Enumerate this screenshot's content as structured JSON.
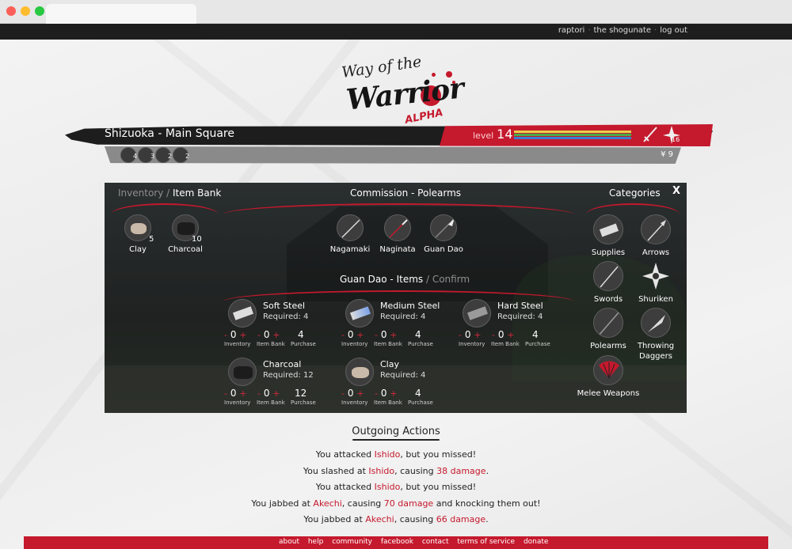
{
  "header": {
    "links": [
      "raptori",
      "the shogunate",
      "log out"
    ]
  },
  "logo": {
    "line1": "Way of the",
    "line2": "Warrior",
    "tag": "ALPHA"
  },
  "location": {
    "title": "Shizuoka - Main Square",
    "level_label": "level",
    "level": "14",
    "weapon_count": "16",
    "money": "¥ 9",
    "quick_items": [
      "4",
      "3",
      "2",
      "2"
    ]
  },
  "inventory": {
    "tab_inventory": "Inventory /",
    "tab_itembank": "Item Bank",
    "items": [
      {
        "name": "Clay",
        "count": "5"
      },
      {
        "name": "Charcoal",
        "count": "10"
      }
    ]
  },
  "commission": {
    "title": "Commission - Polearms",
    "items": [
      "Nagamaki",
      "Naginata",
      "Guan Dao"
    ]
  },
  "categories": {
    "title": "Categories",
    "close": "X",
    "items": [
      "Supplies",
      "Arrows",
      "Swords",
      "Shuriken",
      "Polearms",
      "Throwing Daggers",
      "Melee Weapons"
    ]
  },
  "requirements": {
    "title": "Guan Dao - Items",
    "title_dim": "/ Confirm",
    "caption_inventory": "Inventory",
    "caption_bank": "Item Bank",
    "caption_purchase": "Purchase",
    "minus": "-",
    "plus": "+",
    "items": [
      {
        "name": "Soft Steel",
        "required": "Required: 4",
        "inventory": "0",
        "bank": "0",
        "purchase": "4"
      },
      {
        "name": "Medium Steel",
        "required": "Required: 4",
        "inventory": "0",
        "bank": "0",
        "purchase": "4"
      },
      {
        "name": "Hard Steel",
        "required": "Required: 4",
        "inventory": "0",
        "bank": "0",
        "purchase": "4"
      },
      {
        "name": "Charcoal",
        "required": "Required: 12",
        "inventory": "0",
        "bank": "0",
        "purchase": "12"
      },
      {
        "name": "Clay",
        "required": "Required: 4",
        "inventory": "0",
        "bank": "0",
        "purchase": "4"
      }
    ]
  },
  "actions": {
    "title": "Outgoing Actions",
    "rows": [
      {
        "a": "You attacked ",
        "t": "Ishido",
        "b": ", but you missed!",
        "d": "",
        "c": ""
      },
      {
        "a": "You slashed at ",
        "t": "Ishido",
        "b": ", causing ",
        "d": "38 damage",
        "c": "."
      },
      {
        "a": "You attacked ",
        "t": "Ishido",
        "b": ", but you missed!",
        "d": "",
        "c": ""
      },
      {
        "a": "You jabbed at ",
        "t": "Akechi",
        "b": ", causing ",
        "d": "70 damage",
        "c": " and knocking them out!"
      },
      {
        "a": "You jabbed at ",
        "t": "Akechi",
        "b": ", causing ",
        "d": "66 damage",
        "c": "."
      }
    ]
  },
  "footer": {
    "links": [
      "about",
      "help",
      "community",
      "facebook",
      "contact",
      "terms of service",
      "donate"
    ]
  },
  "colors": {
    "accent": "#c5192d",
    "bar_dark": "#1d1d1d",
    "panel": "#2a2d2c"
  }
}
